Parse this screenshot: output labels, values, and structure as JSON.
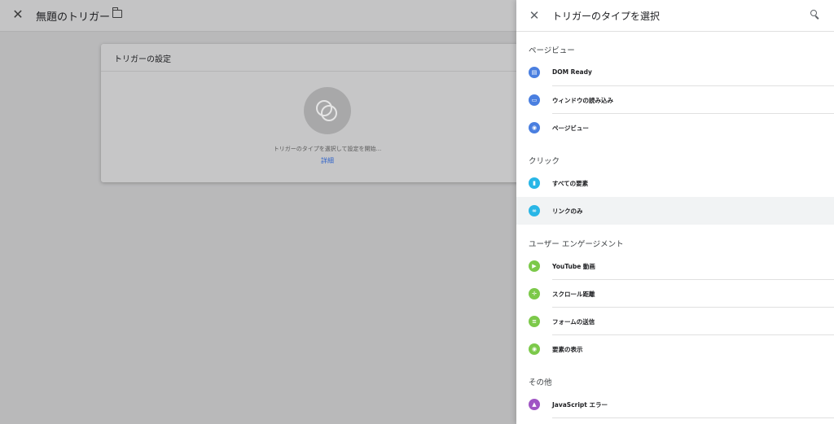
{
  "editor": {
    "title": "無題のトリガー",
    "card_title": "トリガーの設定",
    "hint": "トリガーのタイプを選択して設定を開始...",
    "detail_link": "詳細"
  },
  "panel": {
    "title": "トリガーのタイプを選択",
    "sections": [
      {
        "title": "ページビュー",
        "items": [
          {
            "label": "DOM Ready",
            "icon": "document-icon",
            "color": "#4a7fe0"
          },
          {
            "label": "ウィンドウの読み込み",
            "icon": "window-icon",
            "color": "#4a7fe0"
          },
          {
            "label": "ページビュー",
            "icon": "eye-icon",
            "color": "#4a7fe0"
          }
        ]
      },
      {
        "title": "クリック",
        "items": [
          {
            "label": "すべての要素",
            "icon": "mouse-icon",
            "color": "#29b6e6"
          },
          {
            "label": "リンクのみ",
            "icon": "link-icon",
            "color": "#29b6e6"
          }
        ]
      },
      {
        "title": "ユーザー エンゲージメント",
        "items": [
          {
            "label": "YouTube 動画",
            "icon": "play-icon",
            "color": "#7cc94a"
          },
          {
            "label": "スクロール距離",
            "icon": "move-icon",
            "color": "#7cc94a"
          },
          {
            "label": "フォームの送信",
            "icon": "form-icon",
            "color": "#7cc94a"
          },
          {
            "label": "要素の表示",
            "icon": "eye-icon",
            "color": "#7cc94a"
          }
        ]
      },
      {
        "title": "その他",
        "items": [
          {
            "label": "JavaScript エラー",
            "icon": "warning-icon",
            "color": "#a055c4"
          }
        ]
      }
    ]
  }
}
